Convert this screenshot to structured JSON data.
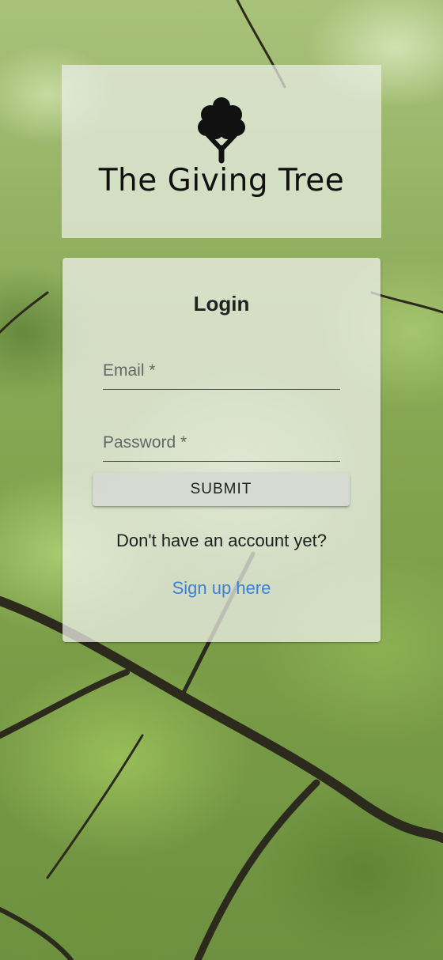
{
  "app": {
    "title": "The Giving Tree",
    "logo_icon": "tree-icon"
  },
  "login": {
    "title": "Login",
    "email_label": "Email *",
    "email_value": "",
    "password_label": "Password *",
    "password_value": "",
    "submit_label": "SUBMIT",
    "signup_prompt": "Don't have an account yet?",
    "signup_link": "Sign up here"
  },
  "colors": {
    "link": "#3b82d6",
    "text": "#222222",
    "card_background": "#f0f1ec"
  }
}
